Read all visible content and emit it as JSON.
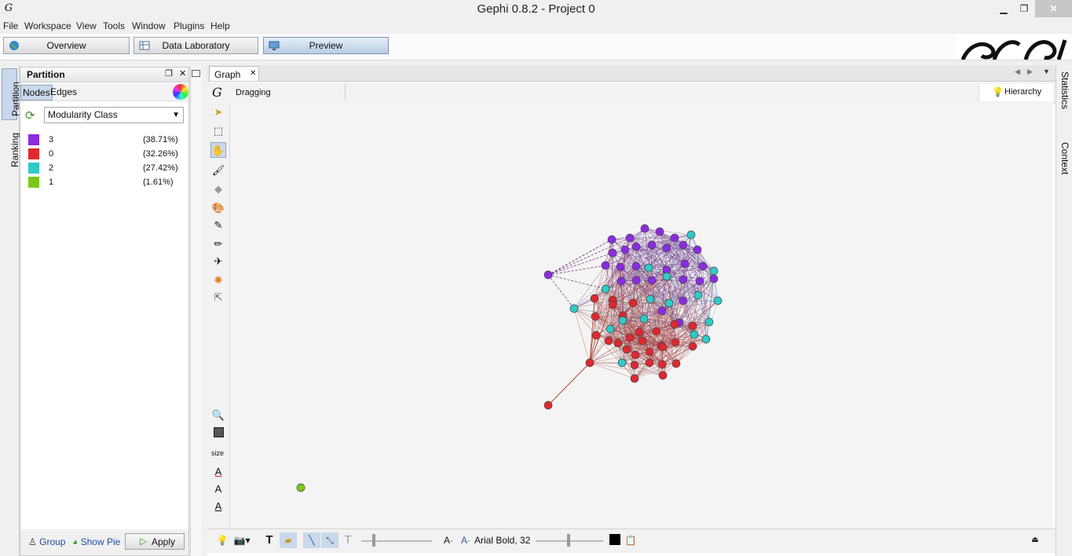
{
  "window": {
    "title": "Gephi 0.8.2 - Project 0",
    "minimize": "▁",
    "maximize": "❐",
    "close": "✕"
  },
  "menu": [
    "File",
    "Workspace",
    "View",
    "Tools",
    "Window",
    "Plugins",
    "Help"
  ],
  "workspaces": {
    "overview": "Overview",
    "data_laboratory": "Data Laboratory",
    "preview": "Preview",
    "active": "Preview"
  },
  "left_tabs": {
    "partition": "Partition",
    "ranking": "Ranking"
  },
  "partition": {
    "title": "Partition",
    "tabs": [
      "Nodes",
      "Edges"
    ],
    "active_tab": "Nodes",
    "attribute": "Modularity Class",
    "classes": [
      {
        "label": "3",
        "percent": "(38.71%)",
        "color": "#8b2be2"
      },
      {
        "label": "0",
        "percent": "(32.26%)",
        "color": "#e0282e"
      },
      {
        "label": "2",
        "percent": "(27.42%)",
        "color": "#2ecbc8"
      },
      {
        "label": "1",
        "percent": "(1.61%)",
        "color": "#7bc71a"
      }
    ],
    "group_label": "Group",
    "show_pie_label": "Show Pie",
    "apply_label": "Apply"
  },
  "graph": {
    "tab_label": "Graph",
    "mode_label": "Dragging",
    "hierarchy_label": "Hierarchy",
    "size_label": "size"
  },
  "bottom_bar": {
    "font_label": "Arial Bold, 32"
  },
  "right_tabs": {
    "statistics": "Statistics",
    "context": "Context"
  }
}
